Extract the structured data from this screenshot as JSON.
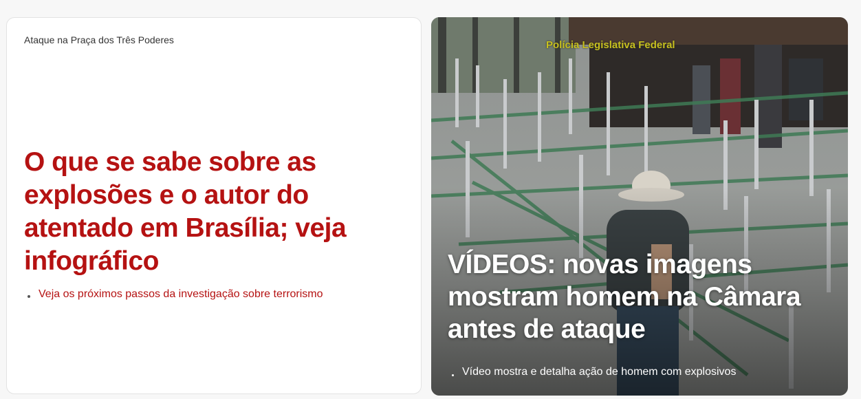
{
  "left_card": {
    "kicker": "Ataque na Praça dos Três Poderes",
    "headline": "O que se sabe sobre as explosões e o autor do atentado em Brasília; veja infográfico",
    "related": "Veja os próximos passos da investigação sobre terrorismo"
  },
  "right_card": {
    "image_overlay_text": "Polícia Legislativa Federal",
    "headline": "VÍDEOS: novas imagens mostram homem na Câmara antes de ataque",
    "related": "Vídeo mostra e detalha ação de homem com explosivos"
  },
  "colors": {
    "headline_red": "#b51212",
    "page_background": "#f7f7f7",
    "card_background": "#ffffff"
  }
}
